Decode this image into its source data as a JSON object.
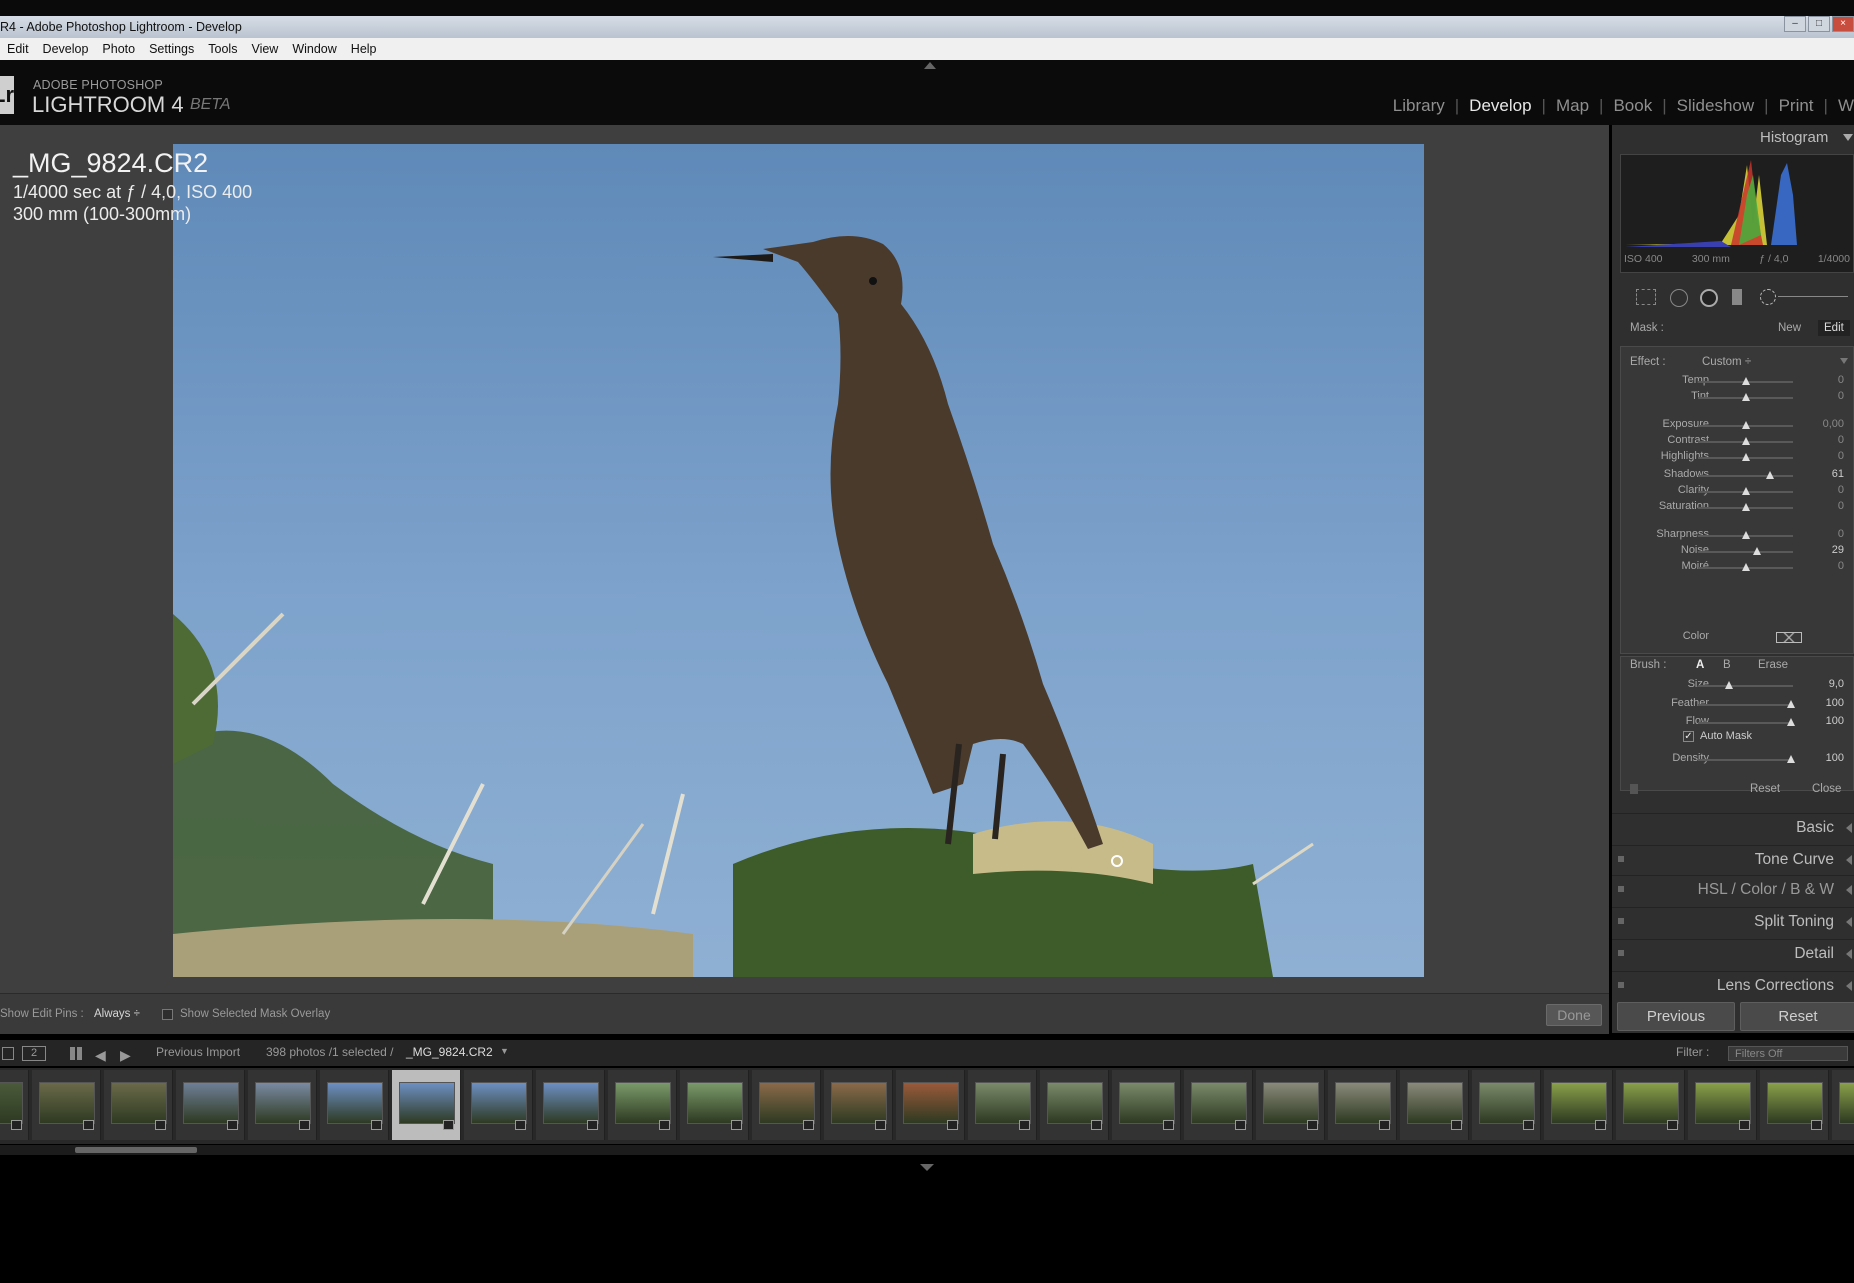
{
  "window": {
    "title": "R4 - Adobe Photoshop Lightroom - Develop",
    "menu": [
      "Edit",
      "Develop",
      "Photo",
      "Settings",
      "Tools",
      "View",
      "Window",
      "Help"
    ]
  },
  "header": {
    "logo": "Lr",
    "brand_line1": "ADOBE PHOTOSHOP",
    "brand_line2": "LIGHTROOM 4",
    "brand_line3": "BETA",
    "modules": [
      "Library",
      "Develop",
      "Map",
      "Book",
      "Slideshow",
      "Print",
      "W"
    ],
    "active_module": "Develop"
  },
  "photo_info": {
    "filename": "_MG_9824.CR2",
    "exposure": "1/4000 sec at ƒ / 4,0, ISO 400",
    "lens": "300 mm (100-300mm)"
  },
  "toolbar": {
    "show_edit_pins_label": "Show Edit Pins :",
    "show_edit_pins_value": "Always ÷",
    "show_mask_overlay": "Show Selected Mask Overlay",
    "done": "Done"
  },
  "right_panel": {
    "histogram_title": "Histogram",
    "histogram_meta": [
      "ISO 400",
      "300 mm",
      "ƒ / 4,0",
      "1/4000"
    ],
    "mask_label": "Mask :",
    "mask_new": "New",
    "mask_edit": "Edit",
    "effect_label": "Effect :",
    "effect_value": "Custom ÷",
    "sliders": [
      {
        "label": "Temp",
        "value": "0",
        "pos": 0.5
      },
      {
        "label": "Tint",
        "value": "0",
        "pos": 0.5
      },
      {
        "label": "Exposure",
        "value": "0,00",
        "pos": 0.5
      },
      {
        "label": "Contrast",
        "value": "0",
        "pos": 0.5
      },
      {
        "label": "Highlights",
        "value": "0",
        "pos": 0.5
      },
      {
        "label": "Shadows",
        "value": "61",
        "pos": 0.76
      },
      {
        "label": "Clarity",
        "value": "0",
        "pos": 0.5
      },
      {
        "label": "Saturation",
        "value": "0",
        "pos": 0.5
      },
      {
        "label": "Sharpness",
        "value": "0",
        "pos": 0.5
      },
      {
        "label": "Noise",
        "value": "29",
        "pos": 0.62
      },
      {
        "label": "Moiré",
        "value": "0",
        "pos": 0.5
      }
    ],
    "color_label": "Color",
    "brush_label": "Brush :",
    "brush_a": "A",
    "brush_b": "B",
    "brush_erase": "Erase",
    "brush_sliders": [
      {
        "label": "Size",
        "value": "9,0",
        "pos": 0.33
      },
      {
        "label": "Feather",
        "value": "100",
        "pos": 0.98
      },
      {
        "label": "Flow",
        "value": "100",
        "pos": 0.98
      }
    ],
    "auto_mask": "Auto Mask",
    "density": {
      "label": "Density",
      "value": "100",
      "pos": 0.98
    },
    "reset": "Reset",
    "close": "Close",
    "sections": [
      "Basic",
      "Tone Curve",
      "HSL / Color / B & W",
      "Split Toning",
      "Detail",
      "Lens Corrections"
    ],
    "previous": "Previous",
    "reset_button": "Reset"
  },
  "filmstrip": {
    "page2": "2",
    "source": "Previous Import",
    "count": "398 photos /1 selected /",
    "selected_file": "_MG_9824.CR2",
    "filter_label": "Filter :",
    "filter_value": "Filters Off"
  }
}
